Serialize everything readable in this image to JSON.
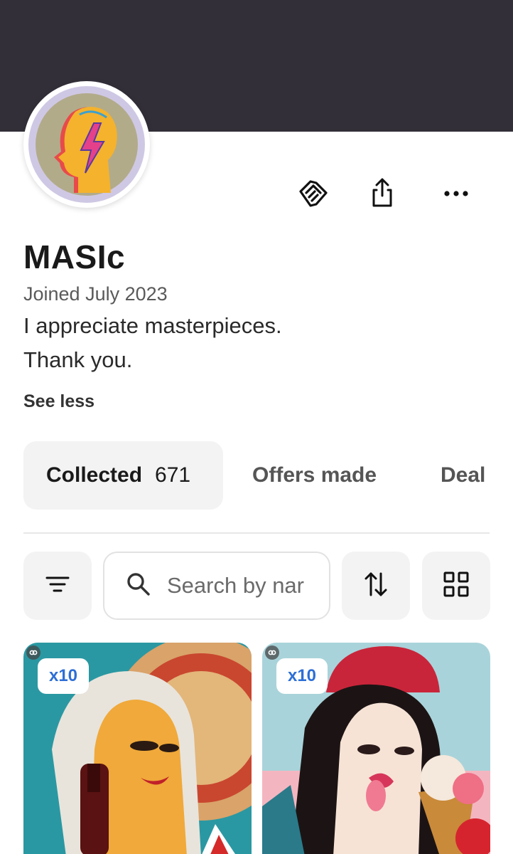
{
  "profile": {
    "username": "MASIc",
    "joined": "Joined July 2023",
    "bio_line1": "I appreciate masterpieces.",
    "bio_line2": "Thank you.",
    "toggle_label": "See less"
  },
  "actions": {
    "icons": [
      "handshake-icon",
      "share-icon",
      "more-icon"
    ]
  },
  "tabs": [
    {
      "label": "Collected",
      "count": "671",
      "active": true
    },
    {
      "label": "Offers made",
      "count": "",
      "active": false
    },
    {
      "label": "Deal",
      "count": "",
      "active": false
    }
  ],
  "toolbar": {
    "search_placeholder": "Search by nar",
    "icons": [
      "filter-icon",
      "search-icon",
      "sort-icon",
      "grid-icon"
    ]
  },
  "items": [
    {
      "quantity": "x10"
    },
    {
      "quantity": "x10"
    }
  ],
  "colors": {
    "banner": "#332f39",
    "badge_text": "#2d6fd6",
    "tab_active_bg": "#f3f3f3"
  }
}
